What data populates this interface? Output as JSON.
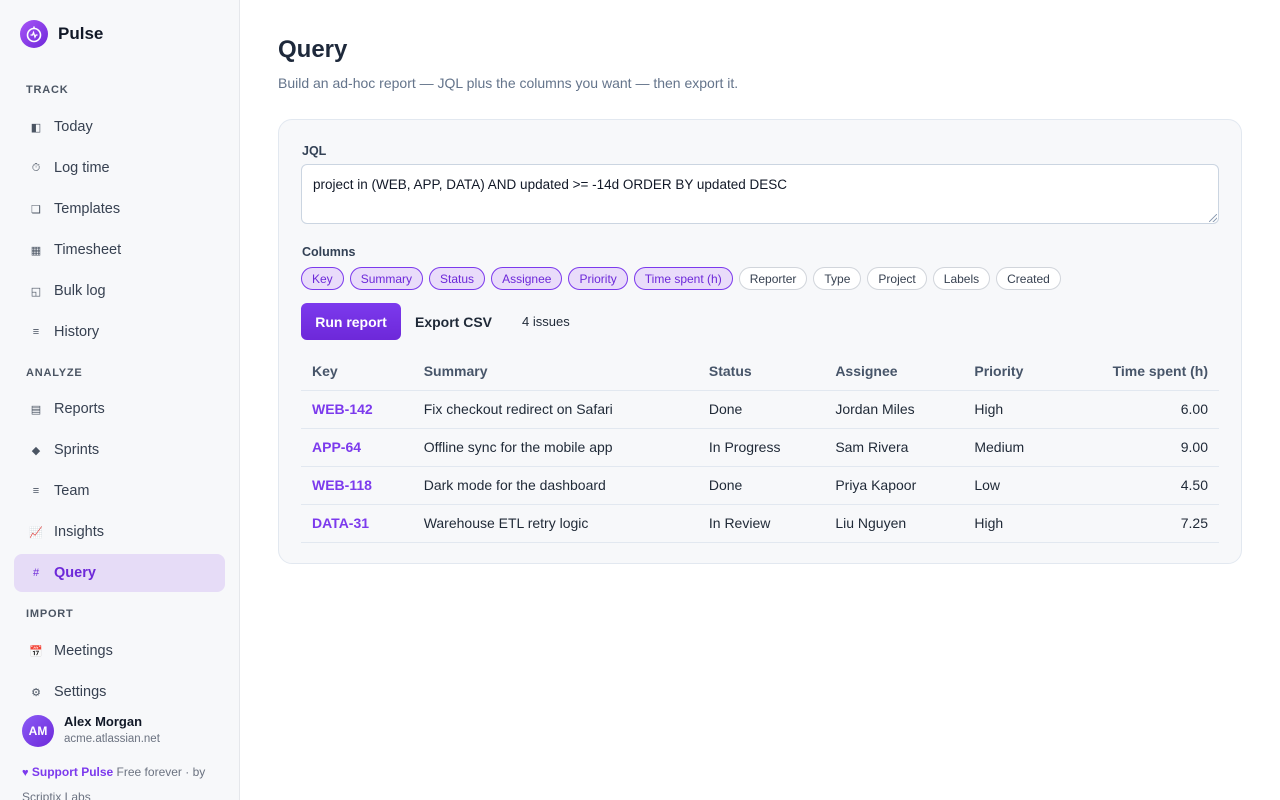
{
  "brand": {
    "name": "Pulse"
  },
  "sidebar": {
    "sections": [
      {
        "title": "TRACK",
        "items": [
          {
            "label": "Today",
            "icon": "today-icon",
            "glyph": "◧"
          },
          {
            "label": "Log time",
            "icon": "stopwatch-icon",
            "glyph": "⏱"
          },
          {
            "label": "Templates",
            "icon": "template-icon",
            "glyph": "❏"
          },
          {
            "label": "Timesheet",
            "icon": "grid-icon",
            "glyph": "▦"
          },
          {
            "label": "Bulk log",
            "icon": "bulk-icon",
            "glyph": "◱"
          },
          {
            "label": "History",
            "icon": "list-icon",
            "glyph": "≡"
          }
        ]
      },
      {
        "title": "ANALYZE",
        "items": [
          {
            "label": "Reports",
            "icon": "reports-icon",
            "glyph": "▤"
          },
          {
            "label": "Sprints",
            "icon": "diamond-icon",
            "glyph": "◆"
          },
          {
            "label": "Team",
            "icon": "team-icon",
            "glyph": "≡"
          },
          {
            "label": "Insights",
            "icon": "chart-icon",
            "glyph": "📈"
          },
          {
            "label": "Query",
            "icon": "hash-icon",
            "glyph": "#",
            "active": true
          }
        ]
      },
      {
        "title": "IMPORT",
        "items": [
          {
            "label": "Meetings",
            "icon": "calendar-icon",
            "glyph": "📅"
          },
          {
            "label": "Settings",
            "icon": "gear-icon",
            "glyph": "⚙"
          }
        ]
      }
    ],
    "user": {
      "initials": "AM",
      "name": "Alex Morgan",
      "site": "acme.atlassian.net"
    },
    "support": {
      "heart": "♥",
      "link": "Support Pulse",
      "text": " Free forever · by Scriptix Labs"
    }
  },
  "main": {
    "title": "Query",
    "subtitle": "Build an ad-hoc report — JQL plus the columns you want — then export it.",
    "jql": {
      "label": "JQL",
      "value": "project in (WEB, APP, DATA) AND updated >= -14d ORDER BY updated DESC"
    },
    "columns": {
      "label": "Columns",
      "chips": [
        {
          "label": "Key",
          "selected": true
        },
        {
          "label": "Summary",
          "selected": true
        },
        {
          "label": "Status",
          "selected": true
        },
        {
          "label": "Assignee",
          "selected": true
        },
        {
          "label": "Priority",
          "selected": true
        },
        {
          "label": "Time spent (h)",
          "selected": true
        },
        {
          "label": "Reporter",
          "selected": false
        },
        {
          "label": "Type",
          "selected": false
        },
        {
          "label": "Project",
          "selected": false
        },
        {
          "label": "Labels",
          "selected": false
        },
        {
          "label": "Created",
          "selected": false
        }
      ]
    },
    "actions": {
      "run": "Run report",
      "export": "Export CSV",
      "count": "4 issues"
    },
    "table": {
      "headers": [
        "Key",
        "Summary",
        "Status",
        "Assignee",
        "Priority",
        "Time spent (h)"
      ],
      "rows": [
        [
          "WEB-142",
          "Fix checkout redirect on Safari",
          "Done",
          "Jordan Miles",
          "High",
          "6.00"
        ],
        [
          "APP-64",
          "Offline sync for the mobile app",
          "In Progress",
          "Sam Rivera",
          "Medium",
          "9.00"
        ],
        [
          "WEB-118",
          "Dark mode for the dashboard",
          "Done",
          "Priya Kapoor",
          "Low",
          "4.50"
        ],
        [
          "DATA-31",
          "Warehouse ETL retry logic",
          "In Review",
          "Liu Nguyen",
          "High",
          "7.25"
        ]
      ]
    }
  },
  "colors": {
    "accent": "#7c3aed",
    "accent_bg": "#e6dcf7",
    "sidebar_bg": "#f7f8fa",
    "card_bg": "#f7f8fa"
  }
}
